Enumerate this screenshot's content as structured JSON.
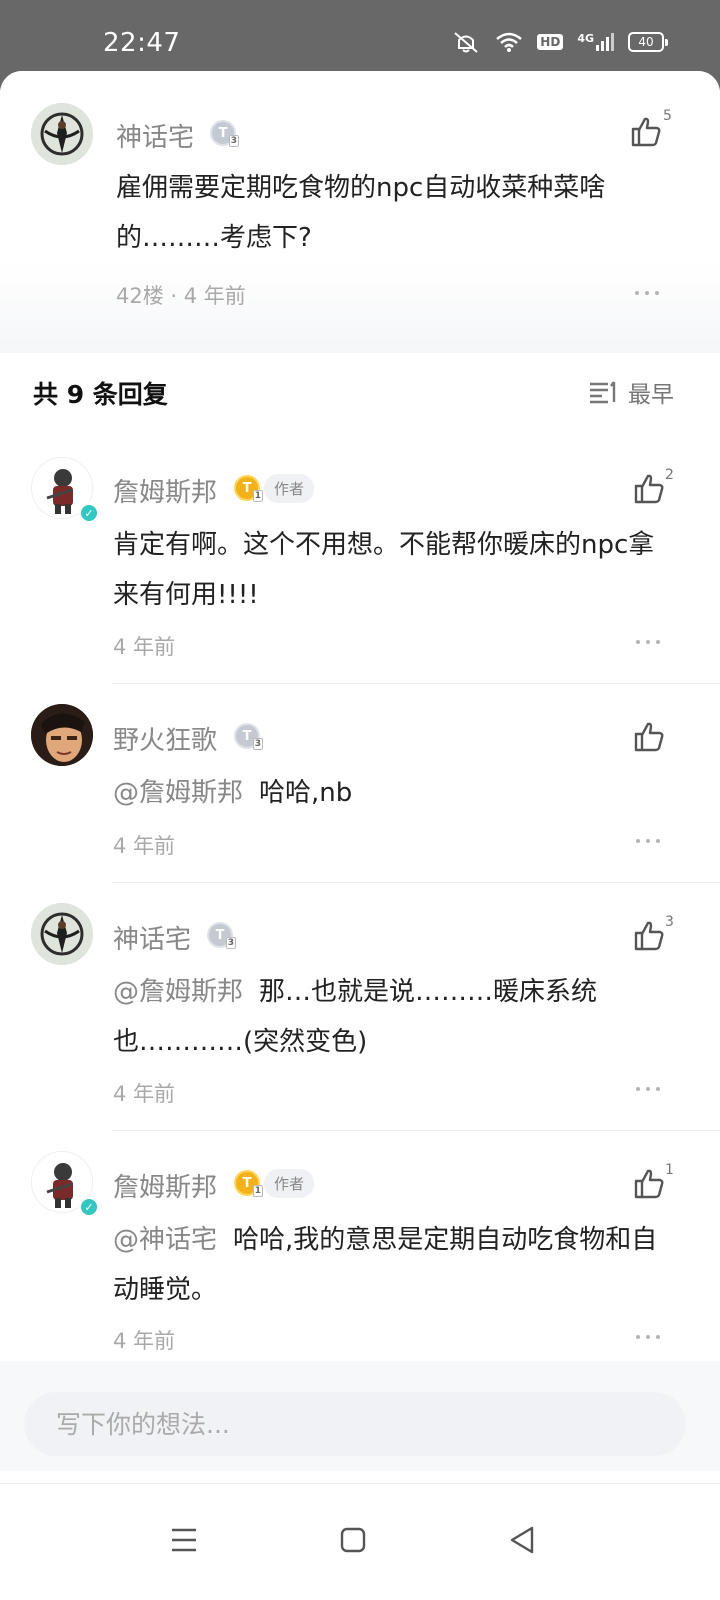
{
  "status_bar": {
    "time": "22:47",
    "hd": "HD",
    "network": "4G",
    "battery": "40"
  },
  "main_comment": {
    "user": "神话宅",
    "text": "雇佣需要定期吃食物的npc自动收菜种菜啥的………考虑下?",
    "floor_meta": "42楼 · 4 年前",
    "likes": "5"
  },
  "replies_header": {
    "title": "共 9 条回复",
    "sort_label": "最早"
  },
  "replies": [
    {
      "user": "詹姆斯邦",
      "author_tag": "作者",
      "mention": "",
      "text": "肯定有啊。这个不用想。不能帮你暖床的npc拿来有何用!!!!",
      "time": "4 年前",
      "likes": "2"
    },
    {
      "user": "野火狂歌",
      "author_tag": "",
      "mention": "@詹姆斯邦",
      "text": "哈哈,nb",
      "time": "4 年前",
      "likes": ""
    },
    {
      "user": "神话宅",
      "author_tag": "",
      "mention": "@詹姆斯邦",
      "text": "那…也就是说………暖床系统也…………(突然变色)",
      "time": "4 年前",
      "likes": "3"
    },
    {
      "user": "詹姆斯邦",
      "author_tag": "作者",
      "mention": "@神话宅",
      "text": "哈哈,我的意思是定期自动吃食物和自动睡觉。",
      "time": "4 年前",
      "likes": "1"
    }
  ],
  "composer": {
    "placeholder": "写下你的想法..."
  },
  "colors": {
    "accent_verify": "#34c6c1",
    "level_gold": "#f3b21b",
    "level_silver": "#c4c9d2",
    "meta_gray": "#a9a9a9"
  }
}
